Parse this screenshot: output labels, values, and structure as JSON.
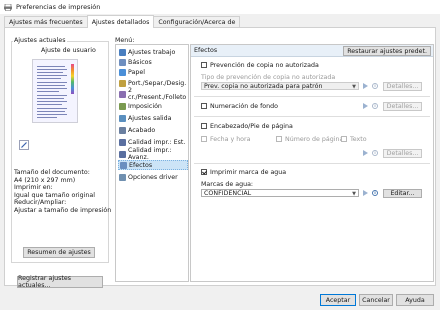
{
  "window": {
    "title": "Preferencias de impresión"
  },
  "tabs": [
    {
      "label": "Ajustes más frecuentes"
    },
    {
      "label": "Ajustes detallados"
    },
    {
      "label": "Configuración/Acerca de"
    }
  ],
  "left": {
    "group_title": "Ajustes actuales",
    "preview_label": "Ajuste de usuario",
    "status_lines": [
      "Tamaño del documento:",
      "  A4 (210 x 297 mm)",
      "Imprimir en:",
      "  Igual que tamaño original",
      "Reducir/Ampliar:",
      "  Ajustar a tamaño de impresión"
    ],
    "summary_button": "Resumen de ajustes",
    "register_button": "Registrar ajustes actuales..."
  },
  "menu": {
    "label": "Menú:",
    "items": [
      {
        "label": "Ajustes trabajo",
        "color": "#4a7fc0"
      },
      {
        "label": "Básicos",
        "color": "#6f8fbf"
      },
      {
        "label": "Papel",
        "color": "#4a8fd8"
      },
      {
        "label": "Port./Separ./Desig.",
        "color": "#c0a040"
      },
      {
        "label": "2 cr./Present./Folleto",
        "color": "#8a6fb0"
      },
      {
        "label": "Imposición",
        "color": "#7a9a50"
      },
      {
        "label": "Ajustes salida",
        "color": "#5a8fbf"
      },
      {
        "label": "Acabado",
        "color": "#6a7fa0"
      },
      {
        "label": "Calidad impr.: Est.",
        "color": "#5a6fa0"
      },
      {
        "label": "Calidad impr.: Avanz.",
        "color": "#5a6fa0"
      },
      {
        "label": "Efectos",
        "color": "#6a8fc0"
      },
      {
        "label": "Opciones driver",
        "color": "#7090b0"
      }
    ],
    "selected_index": 10
  },
  "effects": {
    "header": "Efectos",
    "restore_button": "Restaurar ajustes predet.",
    "copy_prevention": {
      "label": "Prevención de copia no autorizada",
      "checked": false,
      "type_label": "Tipo de prevención de copia no autorizada",
      "type_value": "Prev. copia no autorizada para patrón",
      "details_button": "Detalles..."
    },
    "background_numbering": {
      "label": "Numeración de fondo",
      "checked": false,
      "details_button": "Detalles..."
    },
    "header_footer": {
      "label": "Encabezado/Pie de página",
      "checked": false,
      "options": [
        "Fecha y hora",
        "Número de página",
        "Texto"
      ],
      "details_button": "Detalles..."
    },
    "watermark": {
      "label": "Imprimir marca de agua",
      "checked": true,
      "select_label": "Marcas de agua:",
      "select_value": "CONFIDENCIAL",
      "edit_button": "Editar..."
    }
  },
  "footer": {
    "ok": "Aceptar",
    "cancel": "Cancelar",
    "help": "Ayuda"
  },
  "colors": {
    "accent": "#0078d7",
    "selected_bg": "#cce4f7",
    "header_bg": "#e8f0f8"
  }
}
